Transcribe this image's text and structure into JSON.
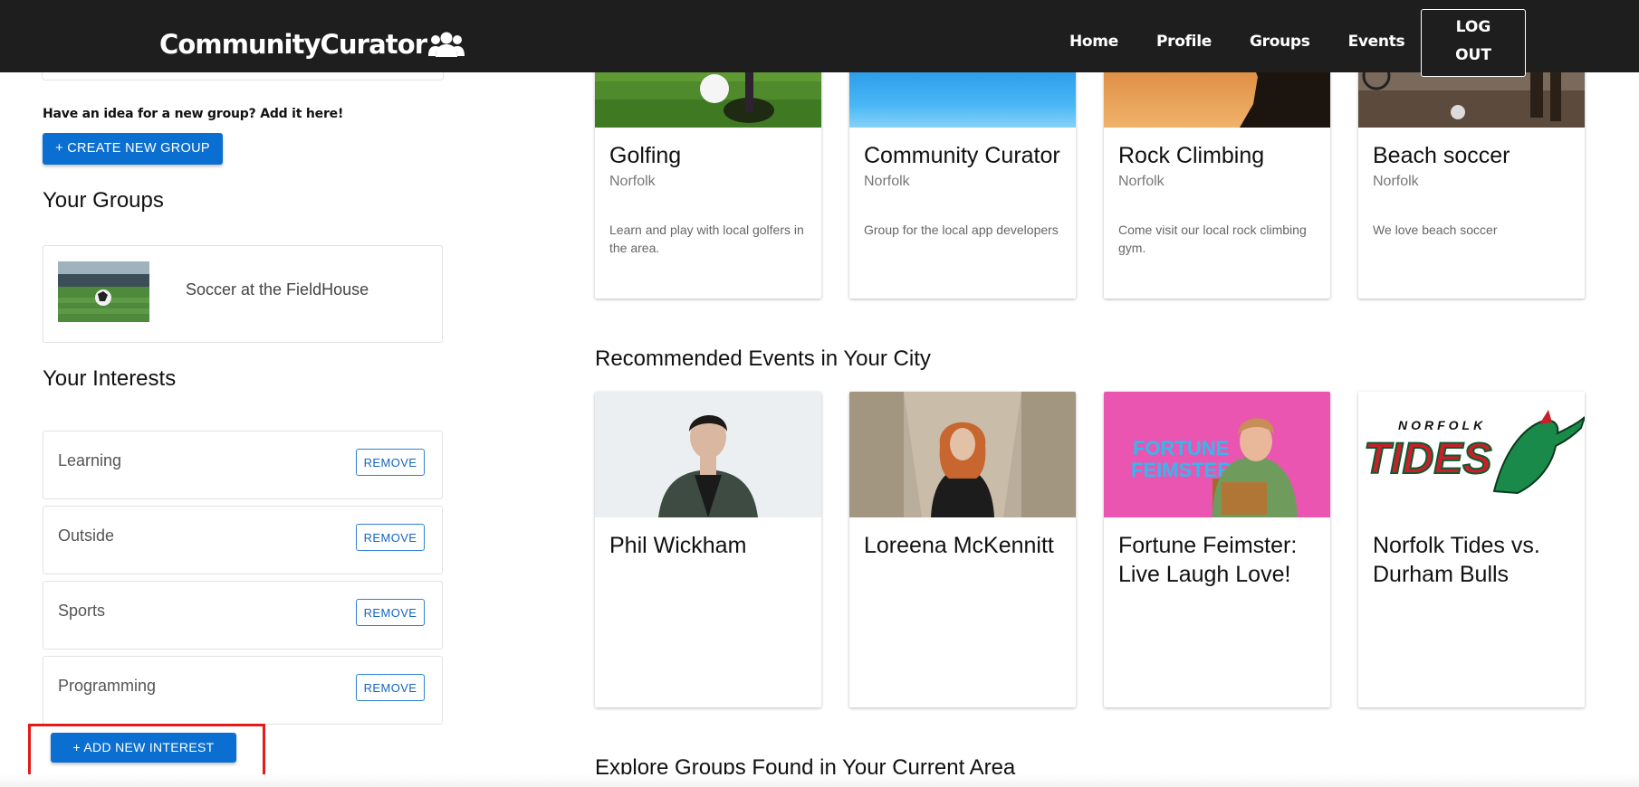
{
  "brand": {
    "name": "CommunityCurator",
    "icon": "users-icon"
  },
  "nav": {
    "links": [
      "Home",
      "Profile",
      "Groups",
      "Events"
    ],
    "logout_line1": "LOG",
    "logout_line2": "OUT"
  },
  "sidebar": {
    "create_prompt": "Have an idea for a new group? Add it here!",
    "create_button": "+ CREATE NEW GROUP",
    "your_groups_title": "Your Groups",
    "groups": [
      {
        "name": "Soccer at the FieldHouse"
      }
    ],
    "your_interests_title": "Your Interests",
    "interests": [
      {
        "label": "Learning",
        "action": "REMOVE"
      },
      {
        "label": "Outside",
        "action": "REMOVE"
      },
      {
        "label": "Sports",
        "action": "REMOVE"
      },
      {
        "label": "Programming",
        "action": "REMOVE"
      }
    ],
    "add_interest_button": "+ ADD NEW INTEREST"
  },
  "group_cards": [
    {
      "title": "Golfing",
      "city": "Norfolk",
      "description": "Learn and play with local golfers in the area."
    },
    {
      "title": "Community Curator",
      "city": "Norfolk",
      "description": "Group for the local app developers"
    },
    {
      "title": "Rock Climbing",
      "city": "Norfolk",
      "description": "Come visit our local rock climbing gym."
    },
    {
      "title": "Beach soccer",
      "city": "Norfolk",
      "description": "We love beach soccer"
    }
  ],
  "events_section_title": "Recommended Events in Your City",
  "event_cards": [
    {
      "title": "Phil Wickham"
    },
    {
      "title": "Loreena McKennitt"
    },
    {
      "title": "Fortune Feimster: Live Laugh Love!",
      "poster_text_line1": "FORTUNE",
      "poster_text_line2": "FEIMSTER"
    },
    {
      "title": "Norfolk Tides vs. Durham Bulls",
      "logo_top": "NORFOLK",
      "logo_main": "TIDES"
    }
  ],
  "explore_section_title": "Explore Groups Found in Your Current Area",
  "colors": {
    "navbar_bg": "#1e1e1e",
    "primary_button": "#0b6fd1",
    "highlight_border": "#e31b1b"
  }
}
